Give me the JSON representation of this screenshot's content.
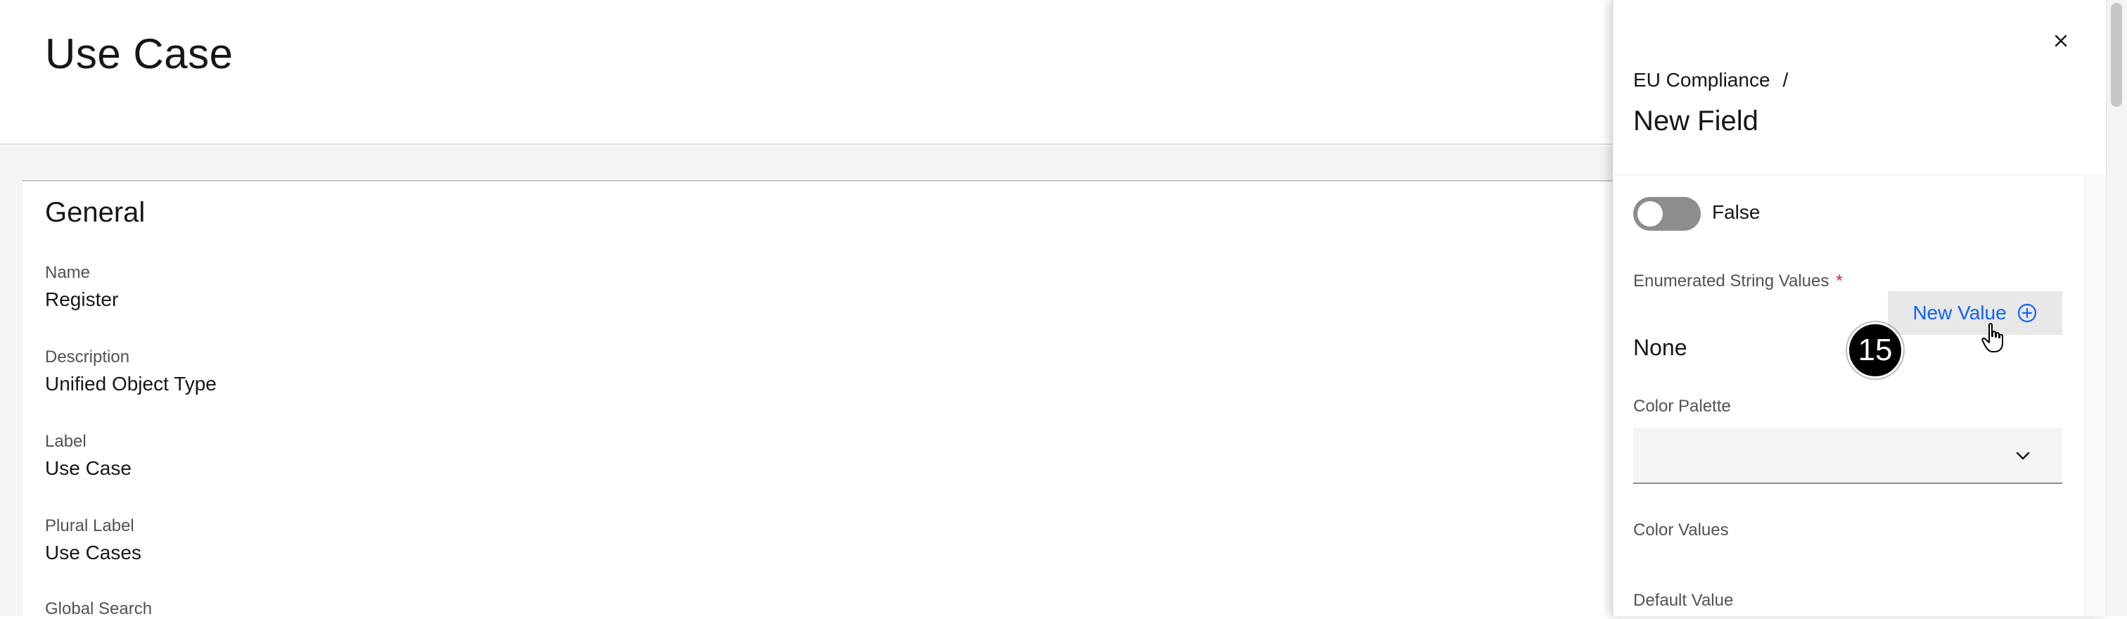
{
  "page": {
    "title": "Use Case",
    "section_title": "General",
    "fields": [
      {
        "label": "Name",
        "value": "Register"
      },
      {
        "label": "Description",
        "value": "Unified Object Type"
      },
      {
        "label": "Label",
        "value": "Use Case"
      },
      {
        "label": "Plural Label",
        "value": "Use Cases"
      },
      {
        "label": "Global Search",
        "value": ""
      }
    ]
  },
  "panel": {
    "breadcrumb": {
      "parent": "EU Compliance",
      "separator": "/"
    },
    "title": "New Field",
    "toggle": {
      "state_text": "False",
      "on": false
    },
    "enumerated_label": "Enumerated String Values",
    "required_mark": "*",
    "new_value_label": "New Value",
    "enumerated_value": "None",
    "color_palette_label": "Color Palette",
    "color_palette_value": "",
    "color_values_label": "Color Values",
    "default_value_label": "Default Value"
  },
  "annotation": {
    "step_number": "15"
  },
  "colors": {
    "accent": "#0f62fe",
    "required": "#da1e28",
    "toggle_off": "#8d8d8d"
  }
}
